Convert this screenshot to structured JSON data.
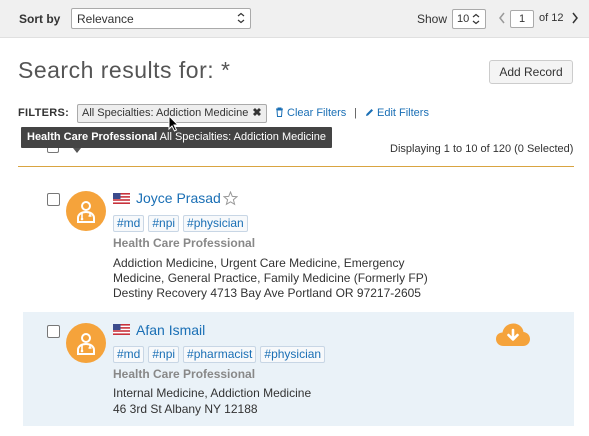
{
  "toolbar": {
    "sort_label": "Sort by",
    "sort_value": "Relevance",
    "show_label": "Show",
    "show_value": "10",
    "page_value": "1",
    "page_of": "of 12"
  },
  "main": {
    "title": "Search results for: *",
    "add_record_label": "Add Record"
  },
  "filters": {
    "label": "FILTERS:",
    "chip_label": "All Specialties: Addiction Medicine",
    "clear_label": "Clear Filters",
    "separator": "|",
    "edit_label": "Edit Filters"
  },
  "tooltip": {
    "bold": "Health Care Professional",
    "text": " All Specialties: Addiction Medicine"
  },
  "results": {
    "displaying": "Displaying 1 to 10 of 120 (0 Selected)"
  },
  "records": [
    {
      "name": "Joyce Prasad",
      "tags": [
        "#md",
        "#npi",
        "#physician"
      ],
      "type": "Health Care Professional",
      "specialties": "Addiction Medicine, Urgent Care Medicine, Emergency Medicine, General Practice, Family Medicine (Formerly FP)",
      "address": "Destiny Recovery 4713 Bay Ave Portland OR 97217-2605"
    },
    {
      "name": "Afan Ismail",
      "tags": [
        "#md",
        "#npi",
        "#pharmacist",
        "#physician"
      ],
      "type": "Health Care Professional",
      "specialties": "Internal Medicine, Addiction Medicine",
      "address": "46 3rd St Albany NY 12188"
    }
  ],
  "colors": {
    "link": "#1a6fb5",
    "avatar": "#f5a33b",
    "divider": "#d9a441",
    "selected_row": "#eaf2f8"
  },
  "icons": {
    "avatar": "doctor-avatar-icon",
    "flag": "us-flag-icon",
    "favorite": "star-outline-icon",
    "download": "cloud-download-icon",
    "clear": "trash-icon",
    "edit": "pencil-icon"
  }
}
